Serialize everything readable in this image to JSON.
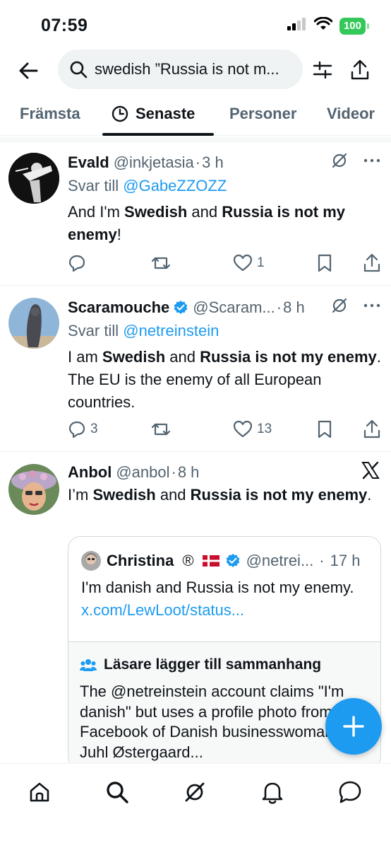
{
  "status_bar": {
    "time": "07:59",
    "battery": "100"
  },
  "search": {
    "query": "swedish ”Russia is not m..."
  },
  "tabs": [
    {
      "label": "Främsta"
    },
    {
      "label": "Senaste"
    },
    {
      "label": "Personer"
    },
    {
      "label": "Videor"
    }
  ],
  "tweets": [
    {
      "name": "Evald",
      "handle": "@inkjetasia",
      "time": "3 h",
      "reply_prefix": "Svar till",
      "reply_to": "@GabeZZOZZ",
      "text_parts": [
        "And I'm ",
        "Swedish",
        " and ",
        "Russia is not my enemy",
        "!"
      ],
      "replies": "",
      "likes": "1"
    },
    {
      "name": "Scaramouche",
      "handle": "@Scaram...",
      "time": "8 h",
      "reply_prefix": "Svar till",
      "reply_to": "@netreinstein",
      "text_parts": [
        "I am ",
        "Swedish",
        " and ",
        "Russia is not my enemy",
        ". The EU is the enemy of all European countries."
      ],
      "replies": "3",
      "likes": "13"
    },
    {
      "name": "Anbol",
      "handle": "@anbol",
      "time": "8 h",
      "text_parts": [
        "I’m ",
        "Swedish",
        " and ",
        "Russia is not my enemy",
        "."
      ]
    }
  ],
  "quote": {
    "name": "Christina",
    "registered_mark": "®",
    "flag": "🇩🇰",
    "handle": "@netrei...",
    "time": "17 h",
    "text": "I'm danish and Russia is not my enemy.",
    "link": "x.com/LewLoot/status..."
  },
  "community_notes": {
    "title": "Läsare lägger till sammanhang",
    "text": "The @netreinstein account claims \"I'm danish\" but uses a profile photo from the Facebook of Danish businesswoman Dorte Juhl Østergaard..."
  },
  "colors": {
    "accent": "#1d9bf0",
    "verified": "#1d9bf0",
    "battery": "#34c759"
  }
}
